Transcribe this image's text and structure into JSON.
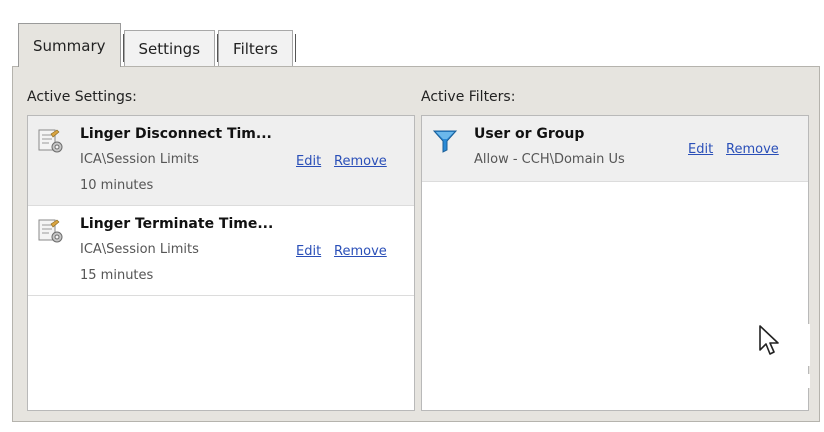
{
  "tabs": [
    {
      "label": "Summary",
      "active": true
    },
    {
      "label": "Settings",
      "active": false
    },
    {
      "label": "Filters",
      "active": false
    }
  ],
  "active_settings": {
    "heading": "Active Settings:",
    "items": [
      {
        "title": "Linger Disconnect Tim...",
        "path": "ICA\\Session Limits",
        "value": "10 minutes",
        "edit": "Edit",
        "remove": "Remove",
        "icon": "policy-setting-icon",
        "selected": true
      },
      {
        "title": "Linger Terminate Time...",
        "path": "ICA\\Session Limits",
        "value": "15 minutes",
        "edit": "Edit",
        "remove": "Remove",
        "icon": "policy-setting-icon",
        "selected": false
      }
    ]
  },
  "active_filters": {
    "heading": "Active Filters:",
    "items": [
      {
        "title": "User or Group",
        "detail": "Allow - CCH\\Domain Us",
        "edit": "Edit",
        "remove": "Remove",
        "icon": "filter-funnel-icon"
      }
    ]
  },
  "colors": {
    "panel_bg": "#e6e4df",
    "link": "#2a4fb8",
    "funnel": "#2a8ad6"
  }
}
